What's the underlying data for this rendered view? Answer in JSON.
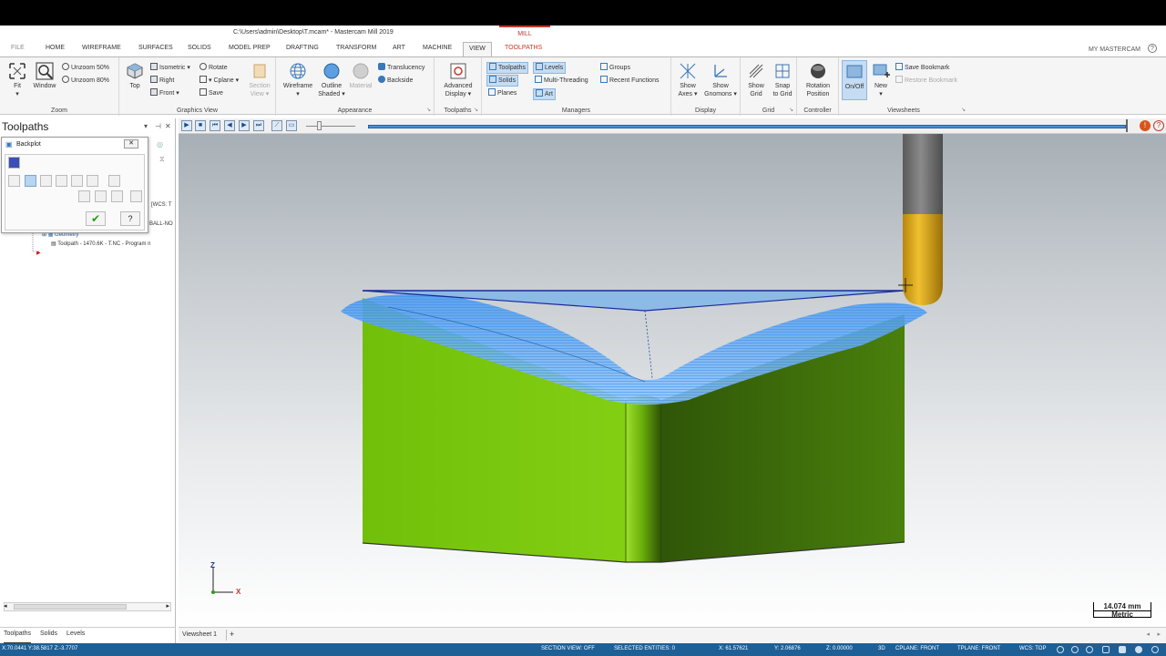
{
  "window": {
    "title": "C:\\Users\\admin\\Desktop\\T.mcam* - Mastercam Mill 2019",
    "context_tab": "MILL",
    "my_mastercam": "MY MASTERCAM"
  },
  "tabs": [
    "FILE",
    "HOME",
    "WIREFRAME",
    "SURFACES",
    "SOLIDS",
    "MODEL PREP",
    "DRAFTING",
    "TRANSFORM",
    "ART",
    "MACHINE",
    "VIEW",
    "TOOLPATHS"
  ],
  "active_tab": "VIEW",
  "ribbon": {
    "zoom": {
      "label": "Zoom",
      "fit": "Fit",
      "window": "Window",
      "unzoom50": "Unzoom 50%",
      "unzoom80": "Unzoom 80%"
    },
    "graphics_view": {
      "label": "Graphics View",
      "top": "Top",
      "isometric": "Isometric",
      "right": "Right",
      "front": "Front",
      "rotate": "Rotate",
      "cplane": "Cplane",
      "save": "Save",
      "section_view_1": "Section",
      "section_view_2": "View"
    },
    "appearance": {
      "label": "Appearance",
      "wireframe": "Wireframe",
      "outline_1": "Outline",
      "outline_2": "Shaded",
      "material": "Material",
      "translucency": "Translucency",
      "backside": "Backside"
    },
    "toolpaths": {
      "label": "Toolpaths",
      "advanced_1": "Advanced",
      "advanced_2": "Display"
    },
    "managers": {
      "label": "Managers",
      "toolpaths": "Toolpaths",
      "solids": "Solids",
      "planes": "Planes",
      "levels": "Levels",
      "multithreading": "Multi-Threading",
      "art": "Art",
      "groups": "Groups",
      "recent_functions": "Recent Functions"
    },
    "display": {
      "label": "Display",
      "show_axes_1": "Show",
      "show_axes_2": "Axes",
      "show_gnomons_1": "Show",
      "show_gnomons_2": "Gnomons"
    },
    "grid": {
      "label": "Grid",
      "show_grid_1": "Show",
      "show_grid_2": "Grid",
      "snap_1": "Snap",
      "snap_2": "to Grid"
    },
    "controller": {
      "label": "Controller",
      "rotation_1": "Rotation",
      "rotation_2": "Position"
    },
    "viewsheets": {
      "label": "Viewsheets",
      "onoff": "On/Off",
      "new": "New",
      "save_bookmark": "Save Bookmark",
      "restore_bookmark": "Restore Bookmark"
    }
  },
  "left_panel": {
    "title": "Toolpaths",
    "tree": {
      "wcs": "[WCS: T",
      "ballnose": "BALL-NO",
      "geometry": "Geometry",
      "toolpath": "Toolpath - 1470.6K - T.NC - Program n"
    },
    "bottom_tabs": [
      "Toolpaths",
      "Solids",
      "Levels"
    ]
  },
  "backplot": {
    "title": "Backplot"
  },
  "viewport": {
    "axis_z": "Z",
    "axis_x": "X",
    "scale_value": "14.074 mm",
    "scale_unit": "Metric"
  },
  "viewsheet_tab": "Viewsheet 1",
  "status": {
    "coords": "X:70.0441   Y:38.5817   Z:-3.7707",
    "section_view": "SECTION VIEW: OFF",
    "selected": "SELECTED ENTITIES: 0",
    "x": "X:  61.57621",
    "y": "Y:  2.06876",
    "z": "Z:  0.00000",
    "mode": "3D",
    "cplane": "CPLANE: FRONT",
    "tplane": "TPLANE: FRONT",
    "wcs": "WCS: TOP"
  },
  "colors": {
    "status_blue": "#1e5f96",
    "face_green": "#7ac70a",
    "face_dark_green": "#3f6b0a",
    "tool_gold": "#d9a514",
    "toolpath_blue": "#2f7fd6"
  }
}
